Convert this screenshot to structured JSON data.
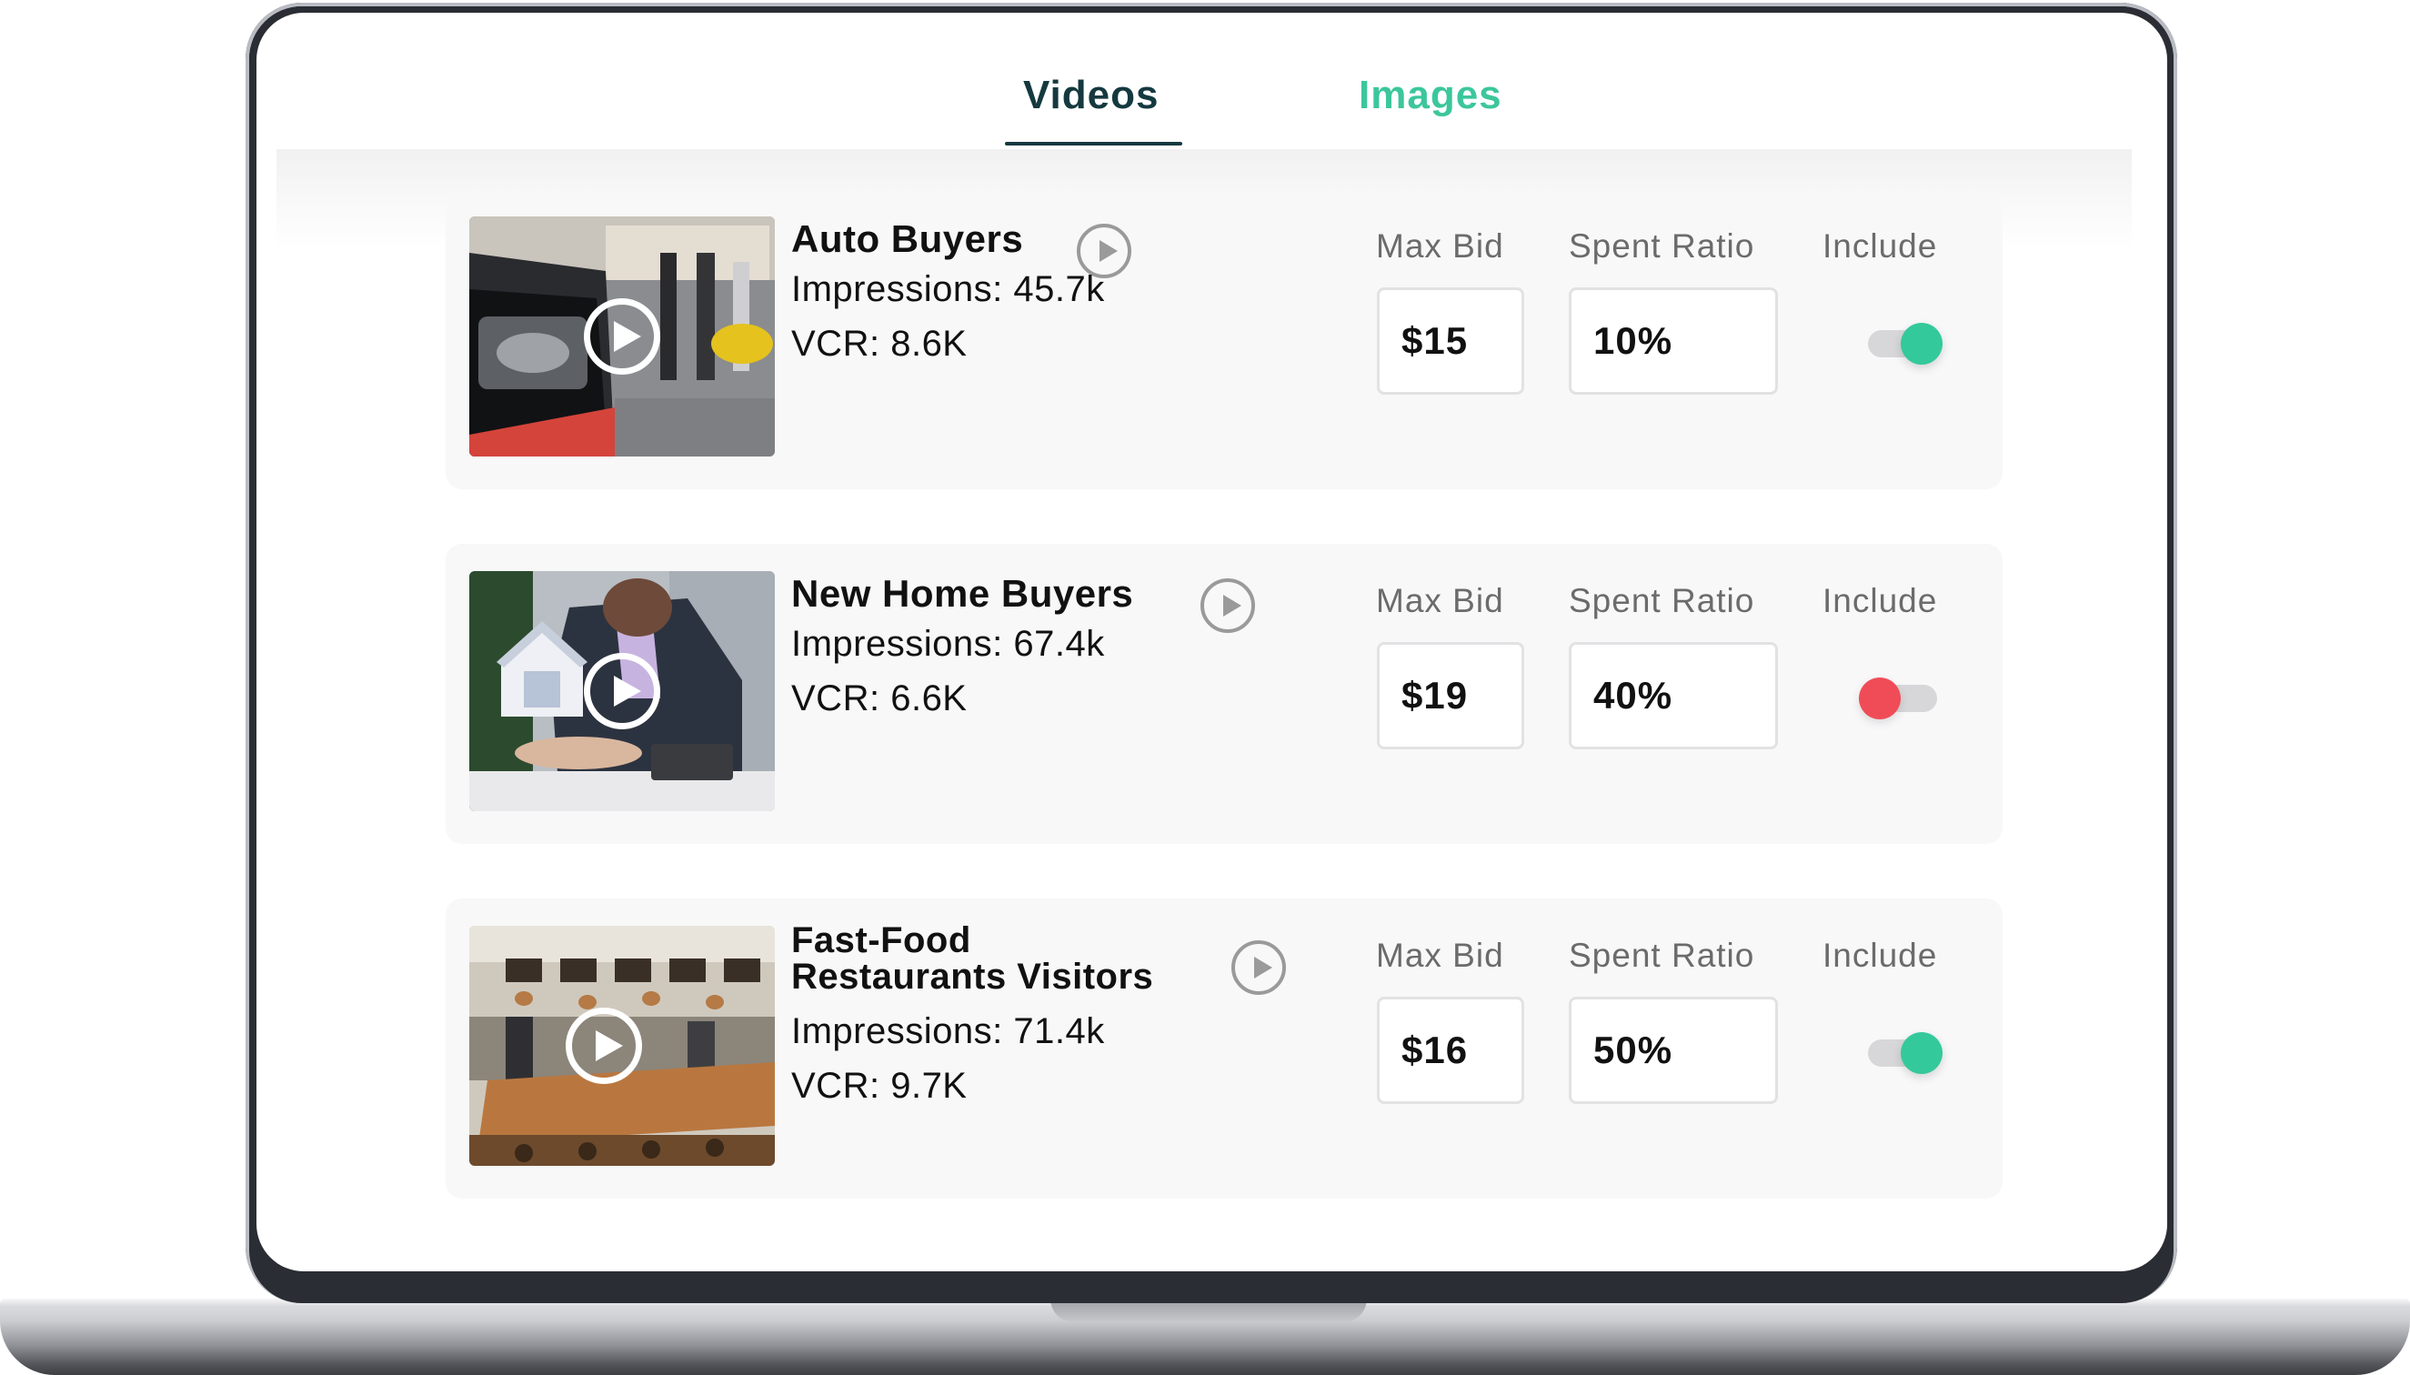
{
  "tabs": [
    {
      "label": "Videos",
      "active": true
    },
    {
      "label": "Images",
      "active": false
    }
  ],
  "colors": {
    "active_tab": "#14393f",
    "inactive_tab": "#3cc69c",
    "toggle_on": "#34c99a",
    "toggle_off": "#f04c57"
  },
  "columns": {
    "max_bid": "Max Bid",
    "spent_ratio": "Spent Ratio",
    "include": "Include"
  },
  "stat_labels": {
    "impressions": "Impressions:",
    "vcr": "VCR:"
  },
  "audiences": [
    {
      "title": "Auto Buyers",
      "thumbnail": "car-show-photo",
      "impressions": "45.7k",
      "vcr": "8.6K",
      "max_bid": "$15",
      "spent_ratio": "10%",
      "include": true
    },
    {
      "title": "New Home Buyers",
      "thumbnail": "house-model-photo",
      "impressions": "67.4k",
      "vcr": "6.6K",
      "max_bid": "$19",
      "spent_ratio": "40%",
      "include": false
    },
    {
      "title_line1": "Fast-Food",
      "title_line2": "Restaurants Visitors",
      "thumbnail": "restaurant-interior-photo",
      "impressions": "71.4k",
      "vcr": "9.7K",
      "max_bid": "$16",
      "spent_ratio": "50%",
      "include": true
    }
  ],
  "icons": {
    "play": "play-circle-icon"
  }
}
